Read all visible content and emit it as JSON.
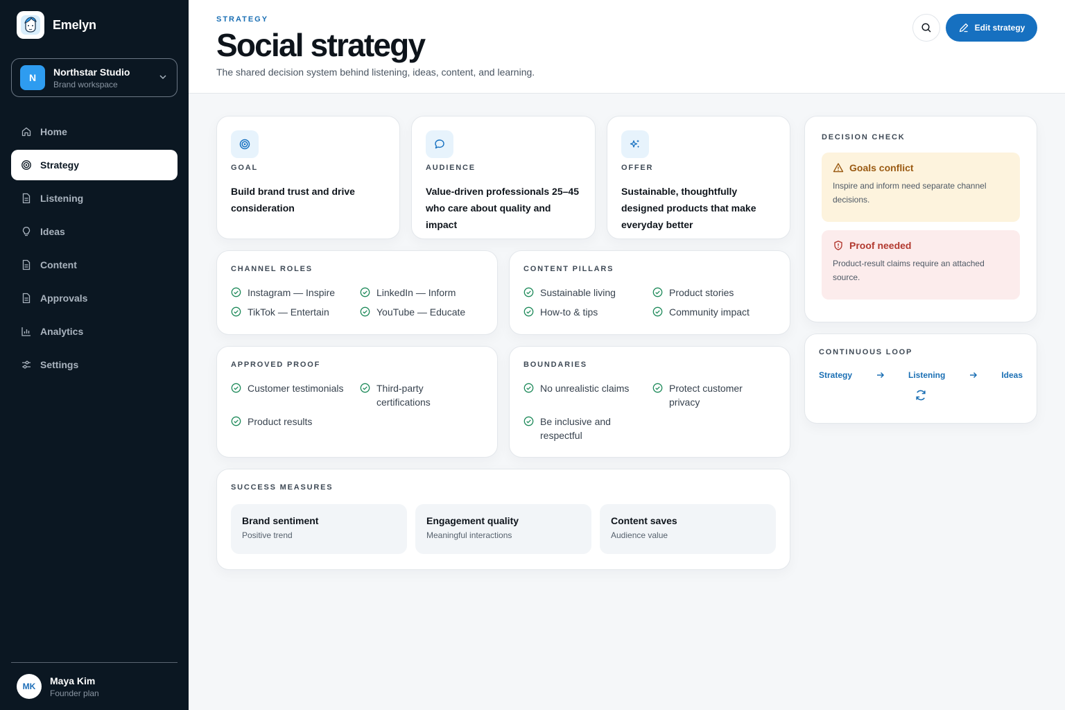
{
  "app": {
    "name": "Emelyn"
  },
  "workspace": {
    "initial": "N",
    "name": "Northstar Studio",
    "subtitle": "Brand workspace"
  },
  "nav": [
    {
      "label": "Home",
      "icon": "home-icon"
    },
    {
      "label": "Strategy",
      "icon": "target-icon",
      "active": true
    },
    {
      "label": "Listening",
      "icon": "document-icon"
    },
    {
      "label": "Ideas",
      "icon": "lightbulb-icon"
    },
    {
      "label": "Content",
      "icon": "document-icon"
    },
    {
      "label": "Approvals",
      "icon": "document-icon"
    },
    {
      "label": "Analytics",
      "icon": "bar-chart-icon"
    },
    {
      "label": "Settings",
      "icon": "sliders-icon"
    }
  ],
  "user": {
    "initials": "MK",
    "name": "Maya Kim",
    "plan": "Founder plan"
  },
  "header": {
    "eyebrow": "STRATEGY",
    "title": "Social strategy",
    "subtitle": "The shared decision system behind listening, ideas, content, and learning.",
    "edit_label": "Edit strategy"
  },
  "goal": {
    "label": "GOAL",
    "text": "Build brand trust and drive consideration"
  },
  "audience": {
    "label": "AUDIENCE",
    "text": "Value-driven professionals 25–45 who care about quality and impact"
  },
  "offer": {
    "label": "OFFER",
    "text": "Sustainable, thoughtfully designed products that make everyday better"
  },
  "channel_roles": {
    "label": "CHANNEL ROLES",
    "items": [
      "Instagram — Inspire",
      "LinkedIn — Inform",
      "TikTok — Entertain",
      "YouTube — Educate"
    ]
  },
  "content_pillars": {
    "label": "CONTENT PILLARS",
    "items": [
      "Sustainable living",
      "Product stories",
      "How-to & tips",
      "Community impact"
    ]
  },
  "approved_proof": {
    "label": "APPROVED PROOF",
    "items": [
      "Customer testimonials",
      "Third-party certifications",
      "Product results"
    ]
  },
  "boundaries": {
    "label": "BOUNDARIES",
    "items": [
      "No unrealistic claims",
      "Protect customer privacy",
      "Be inclusive and respectful"
    ]
  },
  "success_measures": {
    "label": "SUCCESS MEASURES",
    "items": [
      {
        "title": "Brand sentiment",
        "sub": "Positive trend"
      },
      {
        "title": "Engagement quality",
        "sub": "Meaningful interactions"
      },
      {
        "title": "Content saves",
        "sub": "Audience value"
      }
    ]
  },
  "decision_check": {
    "label": "DECISION CHECK",
    "conflict": {
      "title": "Goals conflict",
      "text": "Inspire and inform need separate channel decisions."
    },
    "proof": {
      "title": "Proof needed",
      "text": "Product-result claims require an attached source."
    }
  },
  "loop": {
    "label": "CONTINUOUS LOOP",
    "steps": [
      "Strategy",
      "Listening",
      "Ideas"
    ]
  },
  "colors": {
    "sidebar": "#0b1722",
    "accent": "#1670c0",
    "success": "#1e8a5a",
    "warning_bg": "#fdf3dd",
    "warning_text": "#9a5a12",
    "danger_bg": "#fcecec",
    "danger_text": "#b2392f"
  }
}
